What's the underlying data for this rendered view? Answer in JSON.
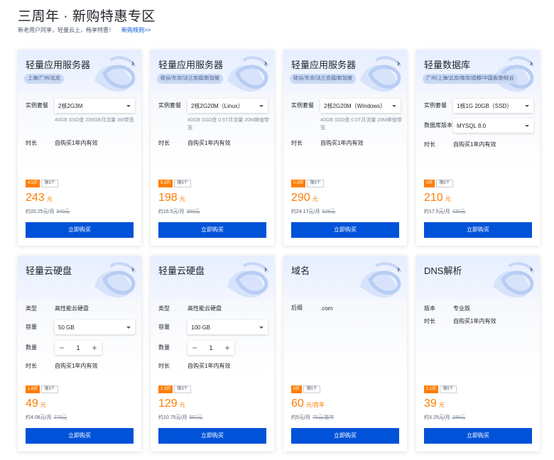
{
  "page": {
    "title": "三周年 · 新购特惠专区",
    "subtitle": "新老用户同享，轻量云上，畅享特惠！",
    "rule_link": "新购规则>>"
  },
  "common": {
    "arrow": "›",
    "buy_label": "立即购买",
    "minus": "−",
    "plus": "+"
  },
  "colors": {
    "accent": "#0052d9",
    "price": "#ff7d00",
    "badge": "#ff7d00"
  },
  "cards": [
    {
      "title": "轻量应用服务器",
      "region": "上海/广州/北京",
      "label_spec": "实例套餐",
      "spec": "2核2G3M",
      "spec_desc": "40GB SSD盘 200GB月流量 3M带宽",
      "label_duration": "时长",
      "duration": "自购买1年内有效",
      "discount": "4.5折",
      "limit": "限3个",
      "price": "243",
      "unit": "元",
      "monthly": "约20.25元/月",
      "original": "540元"
    },
    {
      "title": "轻量应用服务器",
      "region": "硅谷/东京/法兰克福/新加坡",
      "label_spec": "实例套餐",
      "spec": "2核2G20M（Linux）",
      "spec_desc": "40GB SSD盘 0.5T月流量 20M峰值带宽",
      "label_duration": "时长",
      "duration": "自购买1年内有效",
      "discount": "5.5折",
      "limit": "限5个",
      "price": "198",
      "unit": "元",
      "monthly": "约16.5元/月",
      "original": "360元"
    },
    {
      "title": "轻量应用服务器",
      "region": "硅谷/东京/法兰克福/新加坡",
      "label_spec": "实例套餐",
      "spec": "2核2G20M（Windows）",
      "spec_desc": "40GB SSD盘 0.5T月流量 20M峰值带宽",
      "label_duration": "时长",
      "duration": "自购买1年内有效",
      "discount": "5.5折",
      "limit": "限5个",
      "price": "290",
      "unit": "元",
      "monthly": "约24.17元/月",
      "original": "528元"
    },
    {
      "title": "轻量数据库",
      "region": "广州/上海/北京/南京/成都/中国香港/硅谷",
      "label_spec": "实例套餐",
      "spec": "1核1G 20GB（SSD）",
      "label_version": "数据库版本",
      "version": "MYSQL 8.0",
      "label_duration": "时长",
      "duration": "自购买1年内有效",
      "discount": "5折",
      "limit": "限5个",
      "price": "210",
      "unit": "元",
      "monthly": "约17.5元/月",
      "original": "420元"
    },
    {
      "title": "轻量云硬盘",
      "label_type": "类型",
      "type": "高性能云硬盘",
      "label_capacity": "容量",
      "capacity": "50 GB",
      "label_qty": "数量",
      "qty": "1",
      "label_duration": "时长",
      "duration": "自购买1年内有效",
      "discount": "1.8折",
      "limit": "限3个",
      "price": "49",
      "unit": "元",
      "monthly": "约4.08元/月",
      "original": "270元"
    },
    {
      "title": "轻量云硬盘",
      "label_type": "类型",
      "type": "高性能云硬盘",
      "label_capacity": "容量",
      "capacity": "100 GB",
      "label_qty": "数量",
      "qty": "1",
      "label_duration": "时长",
      "duration": "自购买1年内有效",
      "discount": "2.3折",
      "limit": "限3个",
      "price": "129",
      "unit": "元",
      "monthly": "约10.75元/月",
      "original": "552元"
    },
    {
      "title": "域名",
      "label_suffix": "后缀",
      "suffix": ".com",
      "discount": "8折",
      "limit": "限5个",
      "price": "60",
      "unit": "元/首年",
      "monthly": "约5元/月",
      "original": "75元/首年"
    },
    {
      "title": "DNS解析",
      "label_version": "版本",
      "version": "专业版",
      "label_duration": "时长",
      "duration": "自购买1年内有效",
      "discount": "2.1折",
      "limit": "限5个",
      "price": "39",
      "unit": "元",
      "monthly": "约3.25元/月",
      "original": "188元"
    }
  ]
}
